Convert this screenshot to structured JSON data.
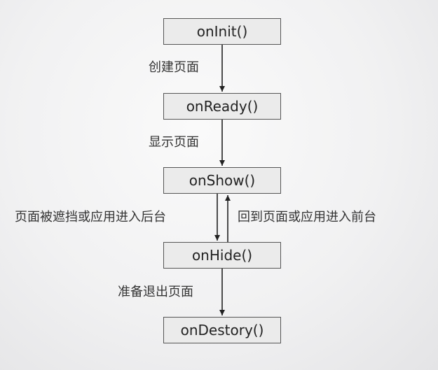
{
  "nodes": {
    "on_init": "onInit()",
    "on_ready": "onReady()",
    "on_show": "onShow()",
    "on_hide": "onHide()",
    "on_destroy": "onDestory()"
  },
  "edges": {
    "init_to_ready": "创建页面",
    "ready_to_show": "显示页面",
    "show_to_hide": "页面被遮挡或应用进入后台",
    "hide_to_show": "回到页面或应用进入前台",
    "hide_to_destroy": "准备退出页面"
  }
}
